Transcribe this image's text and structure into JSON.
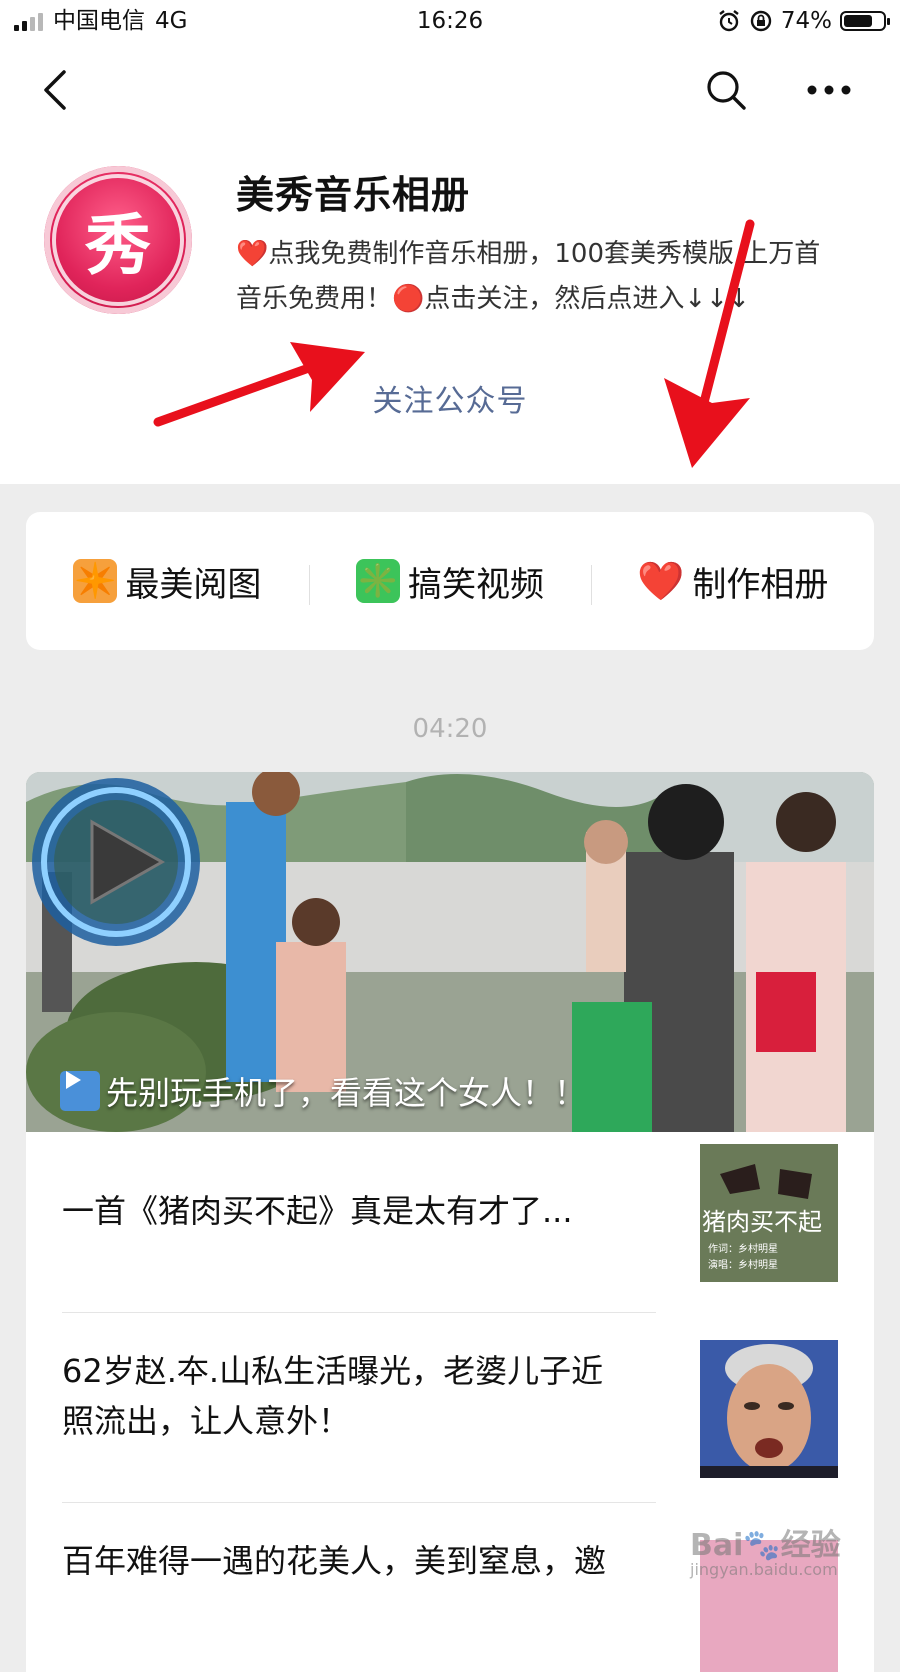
{
  "status_bar": {
    "carrier": "中国电信",
    "network": "4G",
    "time": "16:26",
    "battery": "74%",
    "battery_level": 0.74
  },
  "nav": {
    "back_icon": "chevron-left-icon",
    "search_icon": "search-icon",
    "more_icon": "ellipsis-icon"
  },
  "account": {
    "logo_glyph": "秀",
    "name": "美秀音乐相册",
    "description": "❤️点我免费制作音乐相册，100套美秀模版,上万首音乐免费用！🔴点击关注，然后点进入↓↓↓",
    "follow_label": "关注公众号"
  },
  "menu": {
    "items": [
      {
        "icon": "✴️",
        "label": "最美阅图",
        "icon_color": "#f6a03c"
      },
      {
        "icon": "✳️",
        "label": "搞笑视频",
        "icon_color": "#3cc45a"
      },
      {
        "icon": "❤️",
        "label": "制作相册",
        "icon_color": "#e02030"
      }
    ]
  },
  "feed": {
    "timestamp": "04:20",
    "hero": {
      "prefix_icon": "▶️",
      "title": "先别玩手机了，看看这个女人！！"
    },
    "articles": [
      {
        "title": "一首《猪肉买不起》真是太有才了...",
        "thumb_text": "猪肉买不起",
        "thumb_sub1": "作词：乡村明星",
        "thumb_sub2": "演唱：乡村明星"
      },
      {
        "title": "62岁赵.夲.山私生活曝光，老婆儿子近照流出，让人意外！"
      },
      {
        "title": "百年难得一遇的花美人，美到窒息，邀"
      }
    ]
  },
  "watermark": {
    "logo": "Bai🐾经验",
    "url": "jingyan.baidu.com"
  }
}
